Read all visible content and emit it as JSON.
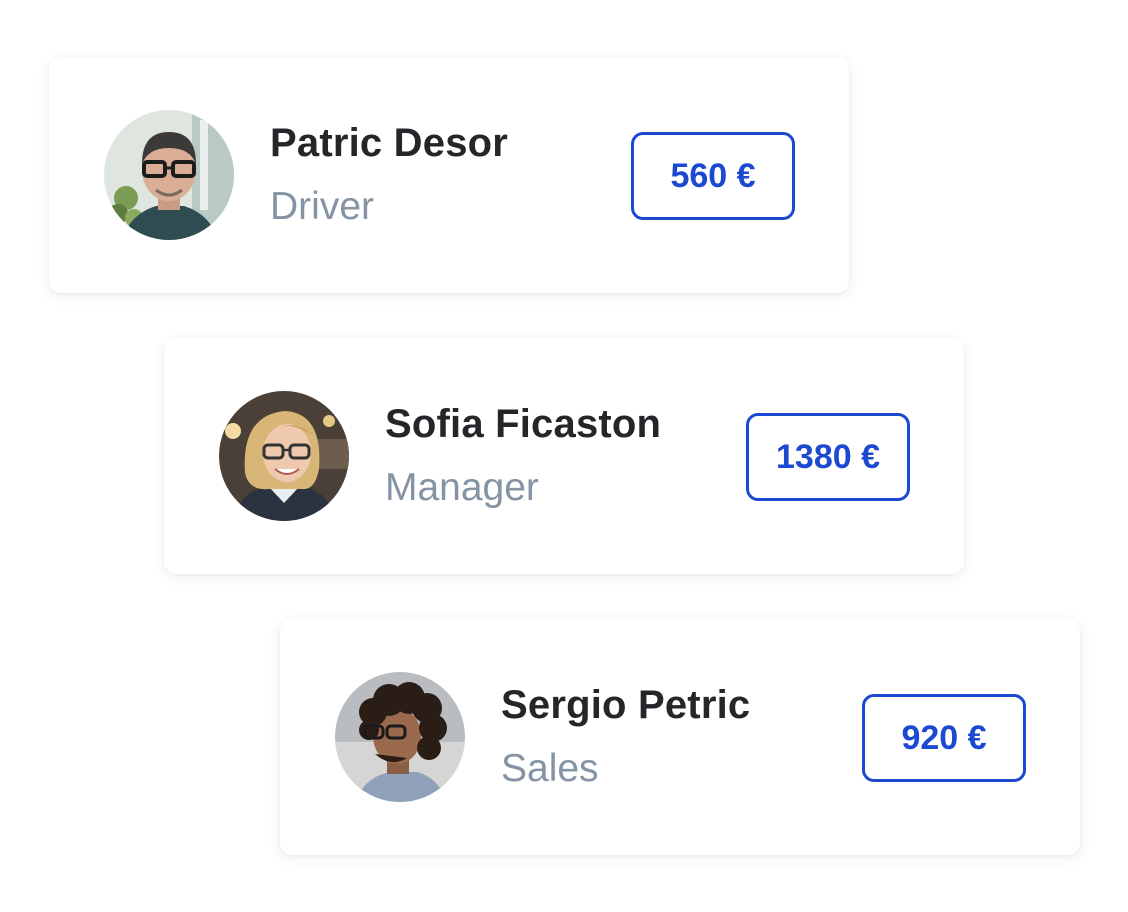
{
  "people": [
    {
      "name": "Patric Desor",
      "role": "Driver",
      "amount": "560 €",
      "avatar_icon": "man-glasses-portrait"
    },
    {
      "name": "Sofia Ficaston",
      "role": "Manager",
      "amount": "1380 €",
      "avatar_icon": "woman-glasses-portrait"
    },
    {
      "name": "Sergio Petric",
      "role": "Sales",
      "amount": "920 €",
      "avatar_icon": "man-curly-hair-portrait"
    }
  ],
  "colors": {
    "accent": "#1b49d1",
    "name_text": "#252629",
    "role_text": "#8494a4",
    "card_background": "#ffffff"
  }
}
